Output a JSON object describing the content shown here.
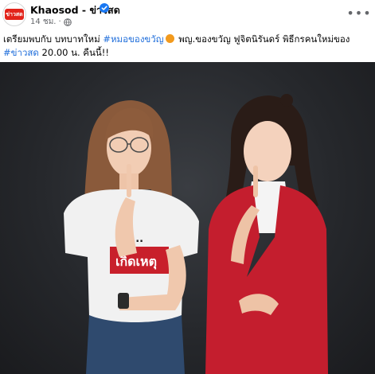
{
  "post": {
    "page_name": "Khaosod - ข่าวสด",
    "timestamp": "14 ชม.",
    "avatar_text": "ข่าวสด",
    "more_icon": "more-horizontal-icon",
    "verified_icon": "verified-badge-icon",
    "audience_icon": "globe-icon"
  },
  "caption": {
    "part1": "เตรียมพบกับ บทบาทใหม่ ",
    "hashtag1": "#หมอของขวัญ",
    "part2": " พญ.ของขวัญ ฟูจิตนิรันดร์ พิธีกรคนใหม่ของ ",
    "hashtag2": "#ข่าวสด",
    "part3": " 20.00 น. คืนนี้!!"
  },
  "photo": {
    "shirt_text": "เกิดเหตุ",
    "shirt_text_top": "ชัด..."
  },
  "colors": {
    "hashtag": "#216fdb",
    "brand_red": "#e2231a",
    "verified": "#1877f2"
  }
}
